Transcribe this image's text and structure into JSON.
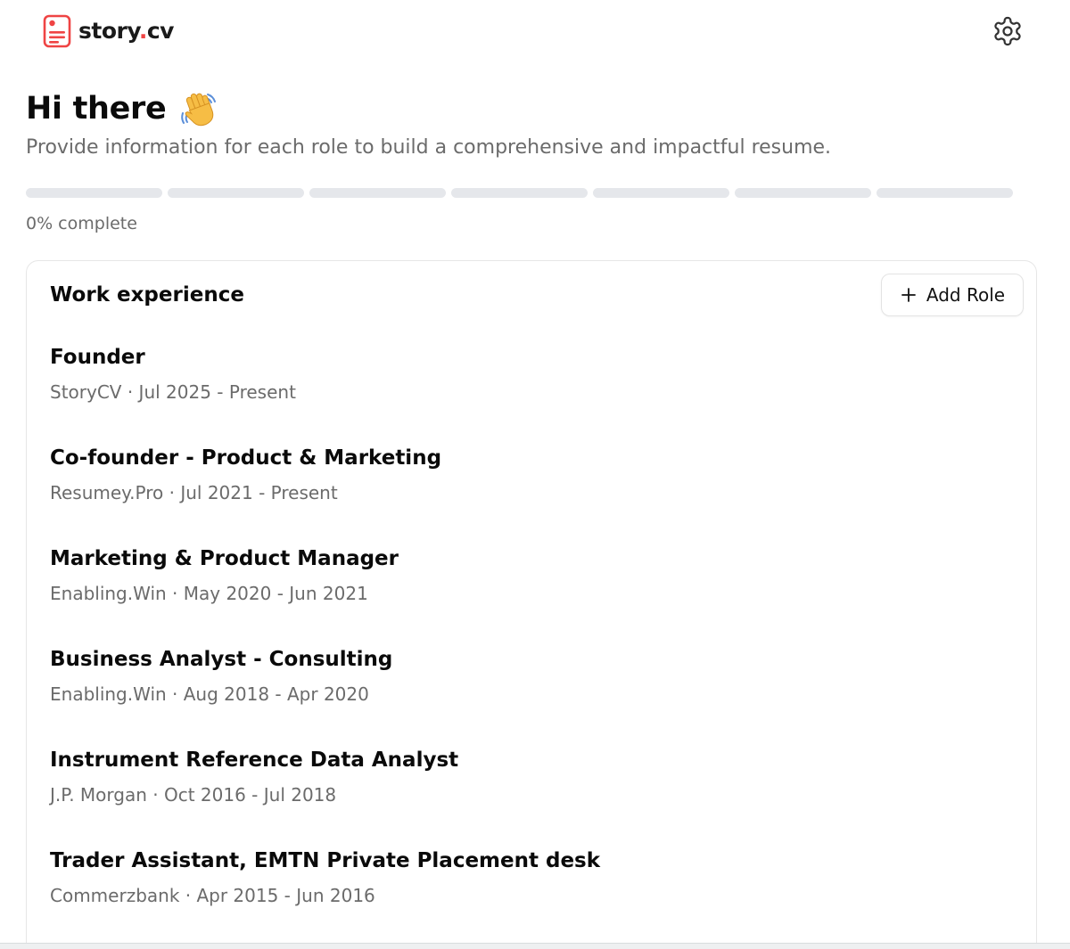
{
  "app": {
    "logo_text_main": "story",
    "logo_text_dot": ".",
    "logo_text_ext": "cv",
    "brand_color": "#ef4444",
    "logo_icon": "document-icon",
    "settings_icon": "gear-icon"
  },
  "greeting": {
    "title": "Hi there",
    "emoji_icon": "waving-hand-icon",
    "subtitle": "Provide information for each role to build a comprehensive and impactful resume."
  },
  "progress": {
    "segments": 7,
    "completed_fraction": 0,
    "label": "0% complete"
  },
  "work_experience": {
    "title": "Work experience",
    "add_label": "Add Role",
    "add_icon": "plus-icon",
    "roles": [
      {
        "title": "Founder",
        "meta": "StoryCV · Jul 2025 - Present"
      },
      {
        "title": "Co-founder - Product & Marketing",
        "meta": "Resumey.Pro · Jul 2021 - Present"
      },
      {
        "title": "Marketing & Product Manager",
        "meta": "Enabling.Win · May 2020 - Jun 2021"
      },
      {
        "title": "Business Analyst - Consulting",
        "meta": "Enabling.Win · Aug 2018 - Apr 2020"
      },
      {
        "title": "Instrument Reference Data Analyst",
        "meta": "J.P. Morgan · Oct 2016 - Jul 2018"
      },
      {
        "title": "Trader Assistant, EMTN Private Placement desk",
        "meta": "Commerzbank · Apr 2015 - Jun 2016"
      }
    ]
  }
}
